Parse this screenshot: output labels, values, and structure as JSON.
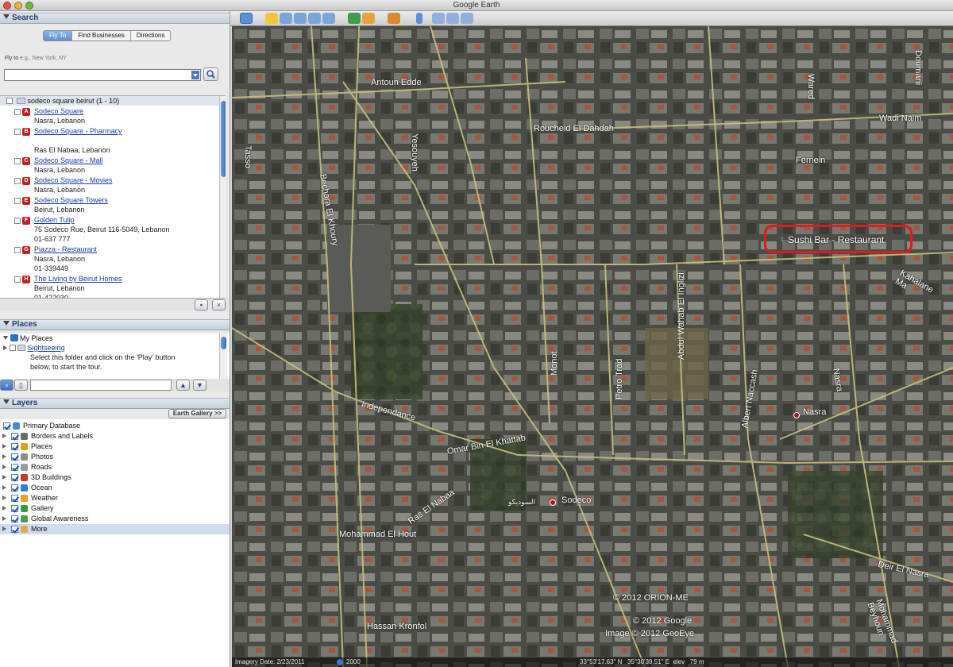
{
  "window": {
    "title": "Google Earth"
  },
  "search": {
    "header": "Search",
    "tabs": [
      "Fly To",
      "Find Businesses",
      "Directions"
    ],
    "fly_label": "Fly to",
    "fly_hint": "e.g., New York, NY",
    "fly_value": "",
    "results_header": "sodeco square beirut (1 - 10)",
    "results": [
      {
        "marker": "A",
        "name": "Sodeco Square",
        "lines": [
          "Nasra, Lebanon"
        ]
      },
      {
        "marker": "B",
        "name": "Sodeco Square - Pharmacy",
        "lines": [
          "",
          "Ras El Nabaa, Lebanon"
        ]
      },
      {
        "marker": "C",
        "name": "Sodeco Square - Mall",
        "lines": [
          "Nasra, Lebanon"
        ]
      },
      {
        "marker": "D",
        "name": "Sodeco Square - Movies",
        "lines": [
          "Nasra, Lebanon"
        ]
      },
      {
        "marker": "E",
        "name": "Sodeco Square Towers",
        "lines": [
          "Beirut, Lebanon"
        ]
      },
      {
        "marker": "F",
        "name": "Golden Tulip",
        "lines": [
          "75 Sodeco Rue, Beirut 116-5049, Lebanon",
          "01-637 777"
        ]
      },
      {
        "marker": "G",
        "name": "Piazza - Restaurant",
        "lines": [
          "Nasra, Lebanon",
          "01-339449"
        ]
      },
      {
        "marker": "H",
        "name": "The Living by Beirut Homes",
        "lines": [
          "Beirut, Lebanon",
          "01-422030"
        ]
      }
    ]
  },
  "places": {
    "header": "Places",
    "my_places": "My Places",
    "sightseeing": "Sightseeing",
    "sightseeing_desc_1": "Select this folder and click on the 'Play' button",
    "sightseeing_desc_2": "below, to start the tour."
  },
  "layers": {
    "header": "Layers",
    "gallery_button": "Earth Gallery >>",
    "items": [
      {
        "label": "Primary Database",
        "icon_color": "#4a8bd6"
      },
      {
        "label": "Borders and Labels",
        "icon_color": "#6a6a6a"
      },
      {
        "label": "Places",
        "icon_color": "#d4a21b"
      },
      {
        "label": "Photos",
        "icon_color": "#8d8d8d"
      },
      {
        "label": "Roads",
        "icon_color": "#9b9b9b"
      },
      {
        "label": "3D Buildings",
        "icon_color": "#c0392b"
      },
      {
        "label": "Ocean",
        "icon_color": "#2e7fd1"
      },
      {
        "label": "Weather",
        "icon_color": "#e8a317"
      },
      {
        "label": "Gallery",
        "icon_color": "#3a9a3a"
      },
      {
        "label": "Global Awareness",
        "icon_color": "#4c9f4c"
      },
      {
        "label": "More",
        "icon_color": "#d8b24a"
      }
    ]
  },
  "map": {
    "street_labels": [
      "Antoun Edde",
      "Roucheid El Dahdah",
      "Wadi Naim",
      "Fernein",
      "Doumani",
      "Wared",
      "Yesouyeh",
      "Tasso",
      "Bechara El Khoury",
      "Independance",
      "Monot",
      "Petro Trad",
      "Abdul Wahab El Inglizi",
      "Albert Naccash",
      "Nasra",
      "Kahalane Ma",
      "Omar Bin El Khattab",
      "Sodeco",
      "Ras El Nabaa",
      "Mohammad El Hout",
      "Hassan Kronfol",
      "Deir El Nasra",
      "Mohammad Beyhoun"
    ],
    "place_labels": {
      "nasra": "Nasra",
      "sodeco": "Sodeco",
      "sodeco_ar": "السوديكو"
    },
    "highlight_label": "Sushi Bar - Restaurant",
    "copyright_1": "© 2012 ORION-ME",
    "copyright_2": "© 2012 Google",
    "copyright_3": "Image © 2012 GeoEye",
    "highlight_color": "#e01b1b"
  },
  "status": {
    "imagery_date": "Imagery Date: 2/23/2011",
    "year": "2000",
    "coords": "33°53'17.63\" N   35°30'39.51\" E  elev   79 m"
  }
}
